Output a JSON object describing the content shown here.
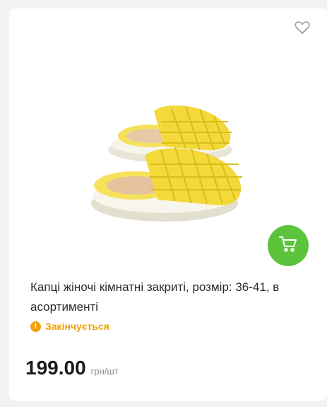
{
  "product": {
    "title": "Капці жіночі кімнатні закриті, розмір: 36-41, в асортименті",
    "status": "Закінчується",
    "price": "199.00",
    "unit": "грн/шт",
    "image": "yellow-slippers"
  },
  "icons": {
    "favorite": "heart-outline-icon",
    "cart": "cart-icon",
    "status": "exclamation-circle-icon"
  },
  "colors": {
    "accent_green": "#5cc33c",
    "warning_orange": "#f0a20a"
  }
}
